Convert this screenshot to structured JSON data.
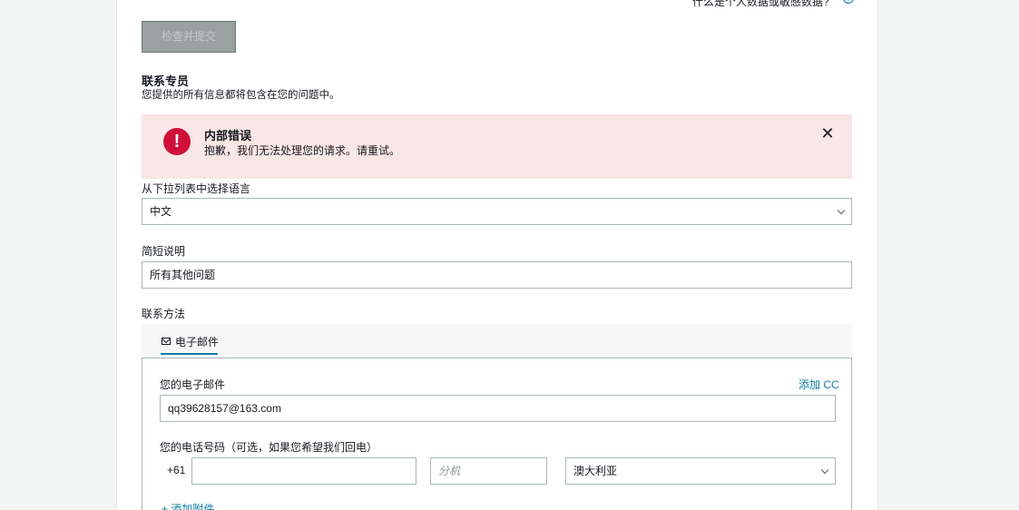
{
  "header": {
    "top_link": "什么是个人数据或敏感数据?",
    "info_icon": "info-icon"
  },
  "submit_button": "检查并提交",
  "contact": {
    "title": "联系专员",
    "description": "您提供的所有信息都将包含在您的问题中。"
  },
  "alert": {
    "title": "内部错误",
    "message": "抱歉，我们无法处理您的请求。请重试。",
    "icon": "error-icon",
    "close_icon": "close-icon",
    "color": "#d0103a"
  },
  "language": {
    "label": "从下拉列表中选择语言",
    "value": "中文"
  },
  "short_desc": {
    "label": "简短说明",
    "value": "所有其他问题"
  },
  "contact_method": {
    "label": "联系方法",
    "tab_label": "电子邮件",
    "tab_icon": "mail-icon"
  },
  "email": {
    "label": "您的电子邮件",
    "add_cc": "添加 CC",
    "value": "qq39628157@163.com"
  },
  "phone": {
    "label": "您的电话号码（可选，如果您希望我们回电）",
    "country_code": "+61",
    "number_value": "",
    "extension_placeholder": "分机",
    "country": "澳大利亚"
  },
  "attachment": {
    "label": "添加附件"
  }
}
